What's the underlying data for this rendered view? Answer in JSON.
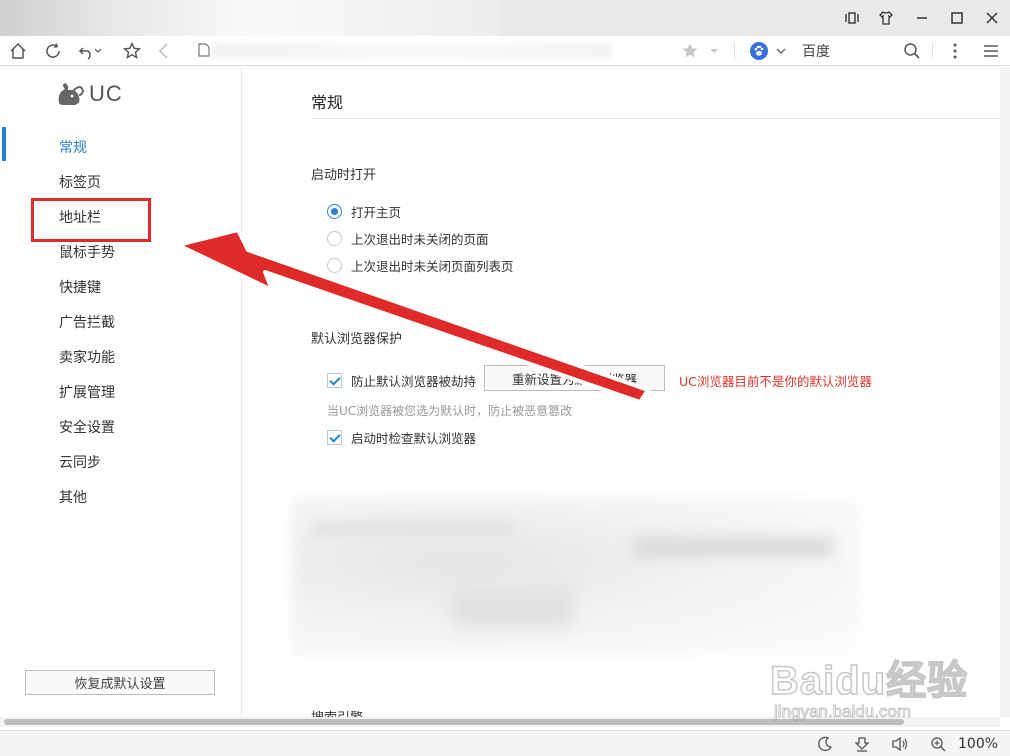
{
  "window": {
    "controls": [
      "tile-icon",
      "skin-icon",
      "minimize-icon",
      "maximize-icon",
      "close-icon"
    ]
  },
  "toolbar": {
    "search_engine_label": "百度",
    "icons": [
      "home-icon",
      "refresh-icon",
      "undo-icon",
      "favorite-icon",
      "back-icon",
      "page-icon",
      "bookmark-star-icon",
      "baidu-paw-icon",
      "search-icon",
      "more-icon",
      "menu-icon"
    ]
  },
  "sidebar": {
    "brand": "UC",
    "items": [
      {
        "label": "常规",
        "active": true
      },
      {
        "label": "标签页"
      },
      {
        "label": "地址栏"
      },
      {
        "label": "鼠标手势"
      },
      {
        "label": "快捷键"
      },
      {
        "label": "广告拦截"
      },
      {
        "label": "卖家功能"
      },
      {
        "label": "扩展管理"
      },
      {
        "label": "安全设置"
      },
      {
        "label": "云同步"
      },
      {
        "label": "其他"
      }
    ],
    "reset_button": "恢复成默认设置"
  },
  "main": {
    "title": "常规",
    "startup": {
      "title": "启动时打开",
      "options": [
        {
          "label": "打开主页",
          "checked": true
        },
        {
          "label": "上次退出时未关闭的页面",
          "checked": false
        },
        {
          "label": "上次退出时未关闭页面列表页",
          "checked": false
        }
      ]
    },
    "default_browser": {
      "title": "默认浏览器保护",
      "prevent_hijack_label": "防止默认浏览器被劫持",
      "reset_button": "重新设置为默认浏览器",
      "warning": "UC浏览器目前不是你的默认浏览器",
      "hint": "当UC浏览器被您选为默认时，防止被恶意篡改",
      "check_on_start_label": "启动时检查默认浏览器"
    },
    "next_section_title": "搜索引擎"
  },
  "statusbar": {
    "zoom": "100%",
    "icons": [
      "night-mode-icon",
      "download-icon",
      "volume-icon",
      "zoom-icon"
    ]
  },
  "watermark": {
    "main": "Baidu经验",
    "sub": "jingyan.baidu.com"
  },
  "colors": {
    "accent": "#2b7fd4",
    "warning": "#d9362b",
    "annotation": "#e02a2a"
  }
}
